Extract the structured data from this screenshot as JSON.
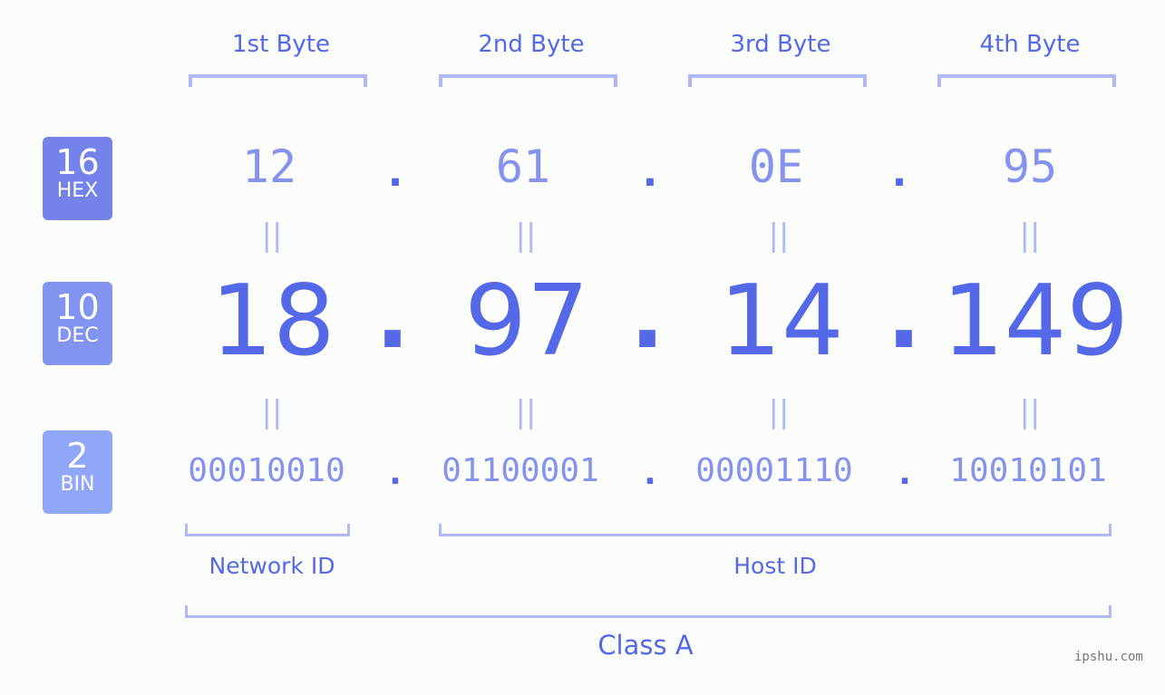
{
  "bytes": [
    {
      "label": "1st Byte",
      "hex": "12",
      "dec": "18",
      "bin": "00010010"
    },
    {
      "label": "2nd Byte",
      "hex": "61",
      "dec": "97",
      "bin": "01100001"
    },
    {
      "label": "3rd Byte",
      "hex": "0E",
      "dec": "14",
      "bin": "00001110"
    },
    {
      "label": "4th Byte",
      "hex": "95",
      "dec": "149",
      "bin": "10010101"
    }
  ],
  "separator": ".",
  "equals": "||",
  "badges": {
    "hex": {
      "num": "16",
      "label": "HEX",
      "color": "#7482ea"
    },
    "dec": {
      "num": "10",
      "label": "DEC",
      "color": "#8393f0"
    },
    "bin": {
      "num": "2",
      "label": "BIN",
      "color": "#90a6f8"
    }
  },
  "network_id_label": "Network ID",
  "host_id_label": "Host ID",
  "class_label": "Class A",
  "watermark": "ipshu.com",
  "colors": {
    "accent": "#5468e8",
    "light": "#8592ee",
    "bracket": "#b0b9f5"
  }
}
